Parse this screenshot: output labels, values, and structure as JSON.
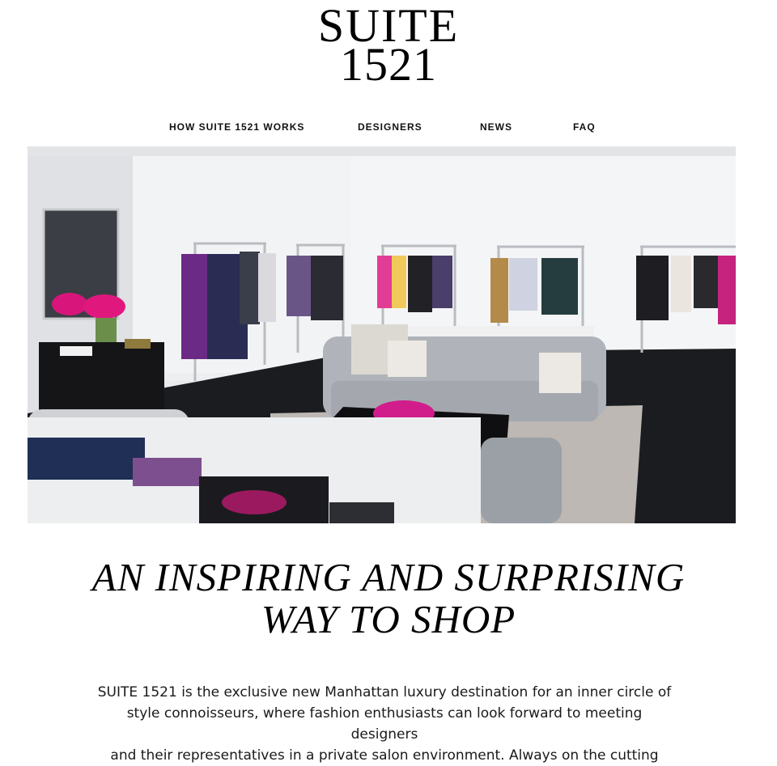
{
  "logo": {
    "line1": "SUITE",
    "line2": "1521"
  },
  "nav": {
    "items": [
      {
        "label": "HOW SUITE 1521 WORKS"
      },
      {
        "label": "DESIGNERS"
      },
      {
        "label": "NEWS"
      },
      {
        "label": "FAQ"
      }
    ]
  },
  "hero": {
    "icon": "showroom-photo"
  },
  "headline": {
    "line1": "AN INSPIRING AND SURPRISING",
    "line2": "WAY TO SHOP"
  },
  "intro": {
    "line1": "SUITE 1521 is the exclusive new Manhattan luxury destination for an inner circle of",
    "line2": "style connoisseurs, where fashion enthusiasts can look forward to meeting designers",
    "line3": "and their representatives in a private salon environment. Always on the cutting"
  },
  "colors": {
    "accent": "#d0187a",
    "text": "#111111",
    "background": "#ffffff"
  }
}
